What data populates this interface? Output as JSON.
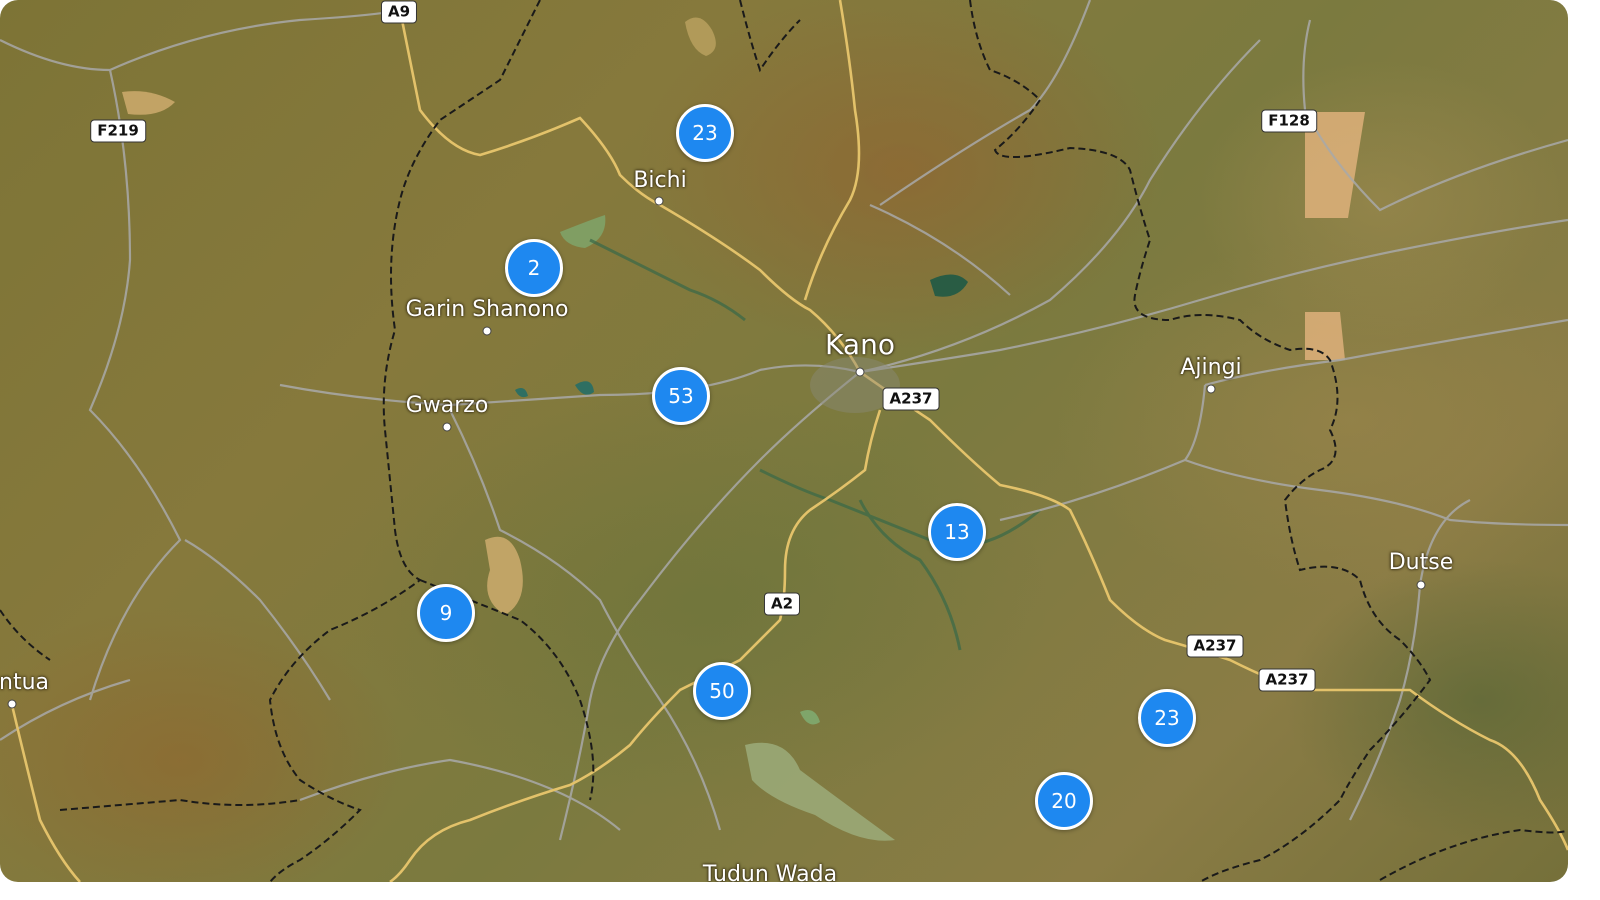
{
  "map": {
    "places": [
      {
        "id": "kano",
        "name": "Kano",
        "size": "big"
      },
      {
        "id": "bichi",
        "name": "Bichi"
      },
      {
        "id": "garin-shanono",
        "name": "Garin Shanono"
      },
      {
        "id": "gwarzo",
        "name": "Gwarzo"
      },
      {
        "id": "ajingi",
        "name": "Ajingi"
      },
      {
        "id": "dutse",
        "name": "Dutse"
      },
      {
        "id": "ntua",
        "name": "ntua"
      },
      {
        "id": "tudun-wada",
        "name": "Tudun Wada"
      }
    ],
    "road_shields": [
      {
        "id": "a9",
        "label": "A9"
      },
      {
        "id": "f219",
        "label": "F219"
      },
      {
        "id": "f128",
        "label": "F128"
      },
      {
        "id": "a237-kano",
        "label": "A237"
      },
      {
        "id": "a2",
        "label": "A2"
      },
      {
        "id": "a237-east",
        "label": "A237"
      },
      {
        "id": "a237-east2",
        "label": "A237"
      }
    ],
    "clusters": [
      {
        "id": "c1",
        "count": "23"
      },
      {
        "id": "c2",
        "count": "2"
      },
      {
        "id": "c3",
        "count": "53"
      },
      {
        "id": "c4",
        "count": "13"
      },
      {
        "id": "c5",
        "count": "9"
      },
      {
        "id": "c6",
        "count": "50"
      },
      {
        "id": "c7",
        "count": "23"
      },
      {
        "id": "c8",
        "count": "20"
      }
    ],
    "colors": {
      "cluster_fill": "#1e88f0",
      "cluster_border": "#ffffff",
      "primary_road": "#e3c26a",
      "secondary_road": "#a9a9a9",
      "boundary": "#1a1a1a",
      "water": "#2f6f52"
    }
  }
}
